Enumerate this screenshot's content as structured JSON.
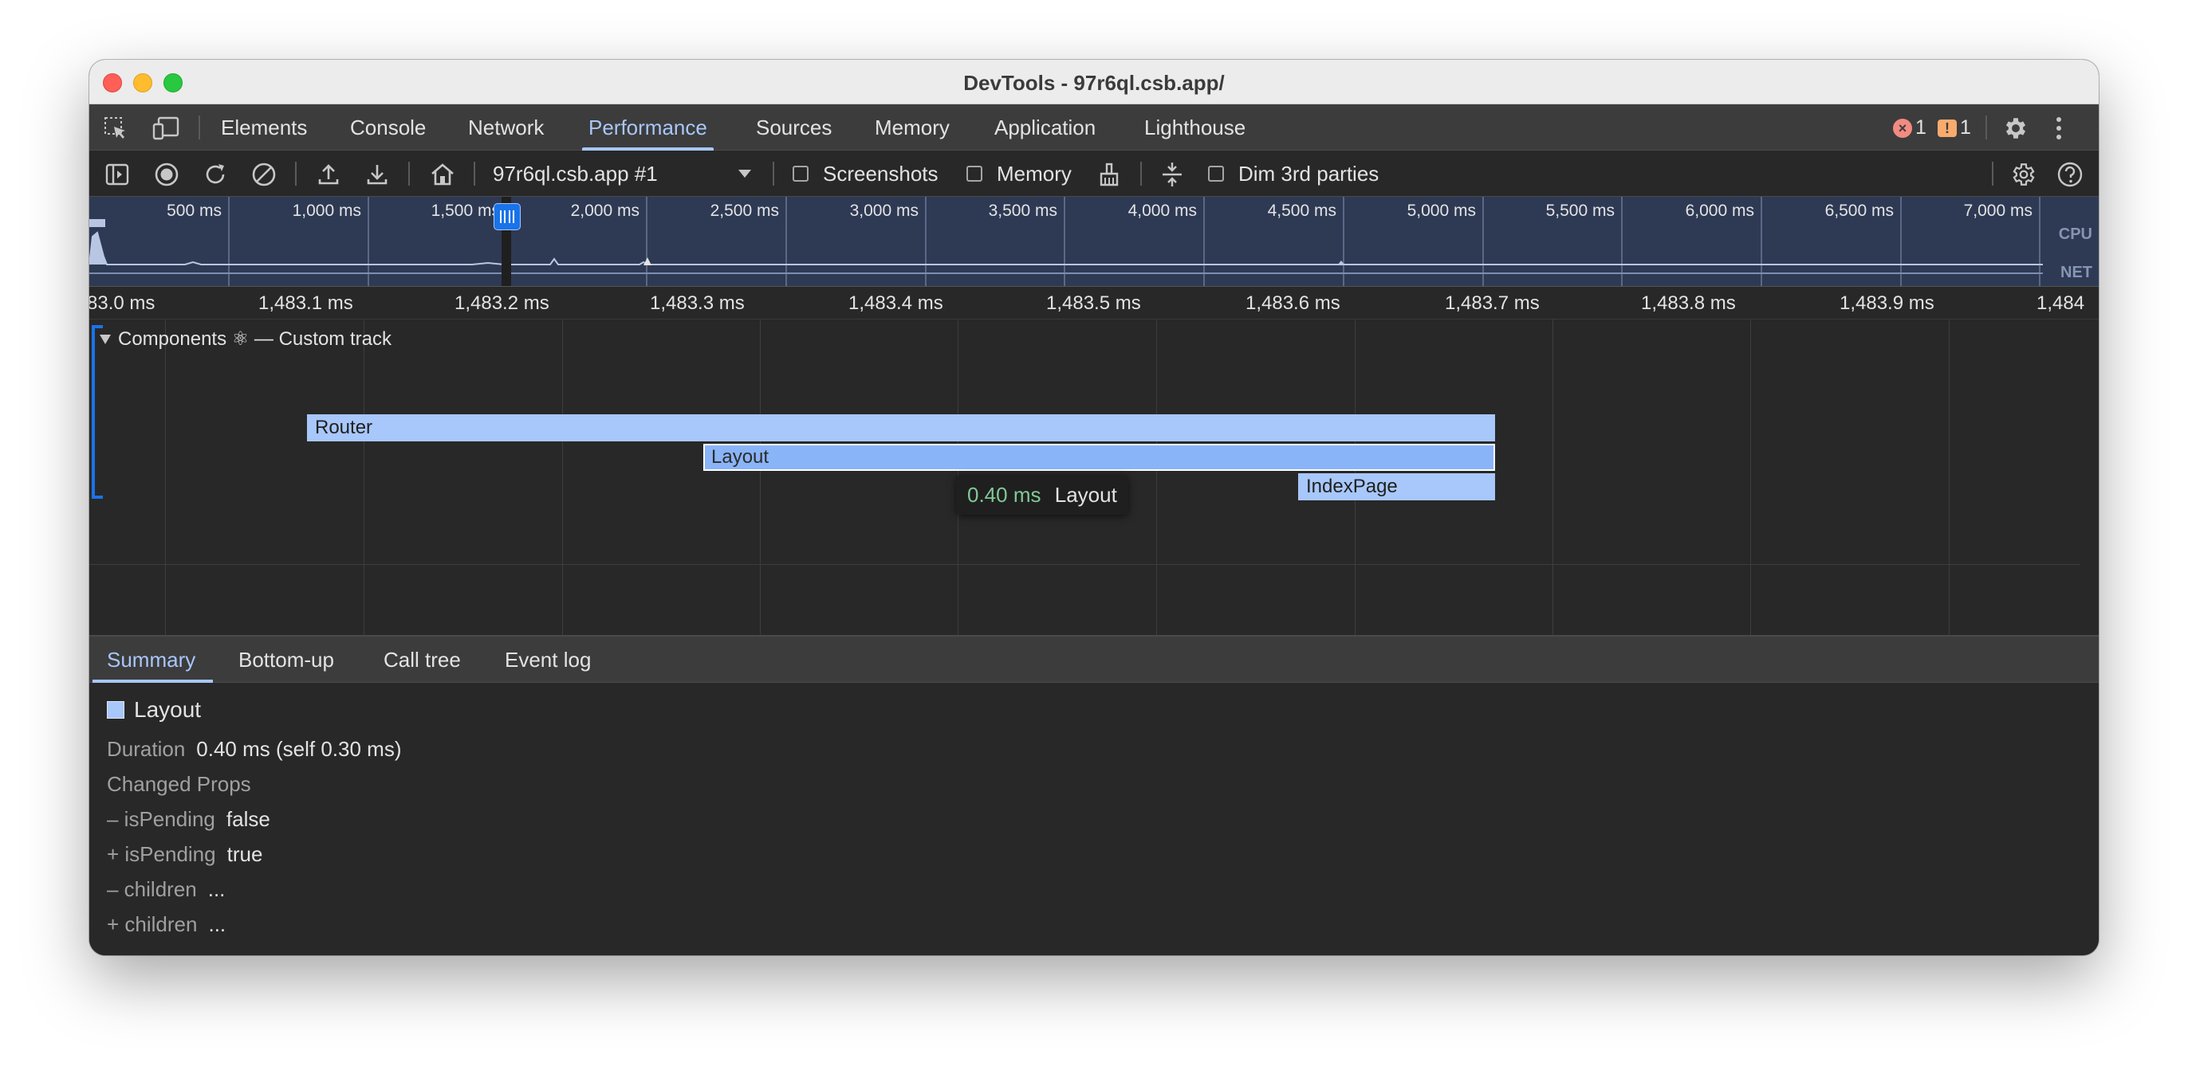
{
  "window": {
    "title": "DevTools - 97r6ql.csb.app/"
  },
  "tabs": [
    "Elements",
    "Console",
    "Network",
    "Performance",
    "Sources",
    "Memory",
    "Application",
    "Lighthouse"
  ],
  "badges": {
    "errors": "1",
    "warnings": "1",
    "error_glyph": "×",
    "warning_glyph": "!"
  },
  "toolbar": {
    "recording_select": "97r6ql.csb.app #1",
    "screenshots_label": "Screenshots",
    "memory_label": "Memory",
    "dim_label": "Dim 3rd parties"
  },
  "overview": {
    "labels": [
      "500 ms",
      "1,000 ms",
      "1,500 ms",
      "2,000 ms",
      "2,500 ms",
      "3,000 ms",
      "3,500 ms",
      "4,000 ms",
      "4,500 ms",
      "5,000 ms",
      "5,500 ms",
      "6,000 ms",
      "6,500 ms",
      "7,000 ms"
    ],
    "cpu_label": "CPU",
    "net_label": "NET"
  },
  "ruler": {
    "labels": [
      "83.0 ms",
      "1,483.1 ms",
      "1,483.2 ms",
      "1,483.3 ms",
      "1,483.4 ms",
      "1,483.5 ms",
      "1,483.6 ms",
      "1,483.7 ms",
      "1,483.8 ms",
      "1,483.9 ms",
      "1,484"
    ]
  },
  "track": {
    "title": "Components ⚛ — Custom track",
    "bars": {
      "router": "Router",
      "layout": "Layout",
      "index": "IndexPage"
    }
  },
  "tooltip": {
    "duration": "0.40 ms",
    "name": "Layout"
  },
  "bottom_tabs": [
    "Summary",
    "Bottom-up",
    "Call tree",
    "Event log"
  ],
  "summary": {
    "title": "Layout",
    "duration_key": "Duration",
    "duration_value": "0.40 ms (self 0.30 ms)",
    "changed_props": "Changed Props",
    "props": [
      {
        "key": "– isPending",
        "value": "false"
      },
      {
        "key": "+ isPending",
        "value": "true"
      },
      {
        "key": "– children",
        "value": "..."
      },
      {
        "key": "+ children",
        "value": "..."
      }
    ]
  }
}
